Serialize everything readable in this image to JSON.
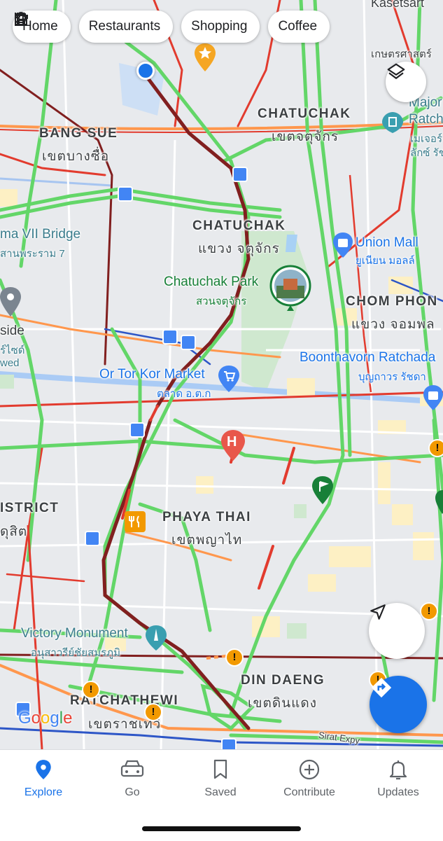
{
  "chips": [
    {
      "label": "Home",
      "icon": "home-icon"
    },
    {
      "label": "Restaurants",
      "icon": "restaurant-icon"
    },
    {
      "label": "Shopping",
      "icon": "shopping-bag-icon"
    },
    {
      "label": "Coffee",
      "icon": "coffee-icon"
    }
  ],
  "labels": {
    "kasetsart": "Kasetsart",
    "kasetsart_th": "เกษตรศาสตร์",
    "chatuchak_dist": "CHATUCHAK",
    "chatuchak_dist_th": "เขตจตุจักร",
    "bang_sue": "BANG SUE",
    "bang_sue_th": "เขตบางซื่อ",
    "major": "Major",
    "ratch": "Ratch",
    "major_th": "เมเจอร์",
    "major_th2": "ลักซ์ รัช",
    "bridge": "ma VII Bridge",
    "bridge_th": "สานพระราม 7",
    "chatuchak_sub": "CHATUCHAK",
    "chatuchak_sub_th": "แขวง จตุจักร",
    "union_mall": "Union Mall",
    "union_mall_th": "ยูเนียน มอลล์",
    "park": "Chatuchak Park",
    "park_th": "สวนจตุจักร",
    "chom_phon": "CHOM PHON",
    "chom_phon_th": "แขวง จอมพล",
    "side": "side",
    "side_th": "ร์ไซด์",
    "side_wed": "wed",
    "boonthavorn": "Boonthavorn Ratchada",
    "boonthavorn_th": "บุญถาวร รัชดา",
    "or_tor_kor": "Or Tor Kor Market",
    "or_tor_kor_th": "ตลาด อ.ต.ก",
    "district": "ISTRICT",
    "district_th": "ดุสิต",
    "phaya_thai": "PHAYA THAI",
    "phaya_thai_th": "เขตพญาไท",
    "victory": "Victory Monument",
    "victory_th": "อนุสาวรีย์ชัยสมรภูมิ",
    "din_daeng": "DIN DAENG",
    "din_daeng_th": "เขตดินแดง",
    "ratchathewi": "RATCHATHEWI",
    "ratchathewi_th": "เขตราชเทวี",
    "sirat": "Sirat Expy",
    "hospital_letter": "H"
  },
  "colors": {
    "traffic_fast": "#63d668",
    "traffic_medium": "#ff974d",
    "traffic_slow": "#e23b2e",
    "traffic_stop": "#811f1f",
    "accent": "#1a73e8"
  },
  "nav": [
    {
      "label": "Explore",
      "icon": "location-pin-icon",
      "active": true
    },
    {
      "label": "Go",
      "icon": "car-icon",
      "active": false
    },
    {
      "label": "Saved",
      "icon": "bookmark-icon",
      "active": false
    },
    {
      "label": "Contribute",
      "icon": "add-circle-icon",
      "active": false
    },
    {
      "label": "Updates",
      "icon": "bell-icon",
      "active": false
    }
  ],
  "attribution": {
    "g": "G",
    "o1": "o",
    "o2": "o",
    "g2": "g",
    "l": "l",
    "e": "e"
  }
}
